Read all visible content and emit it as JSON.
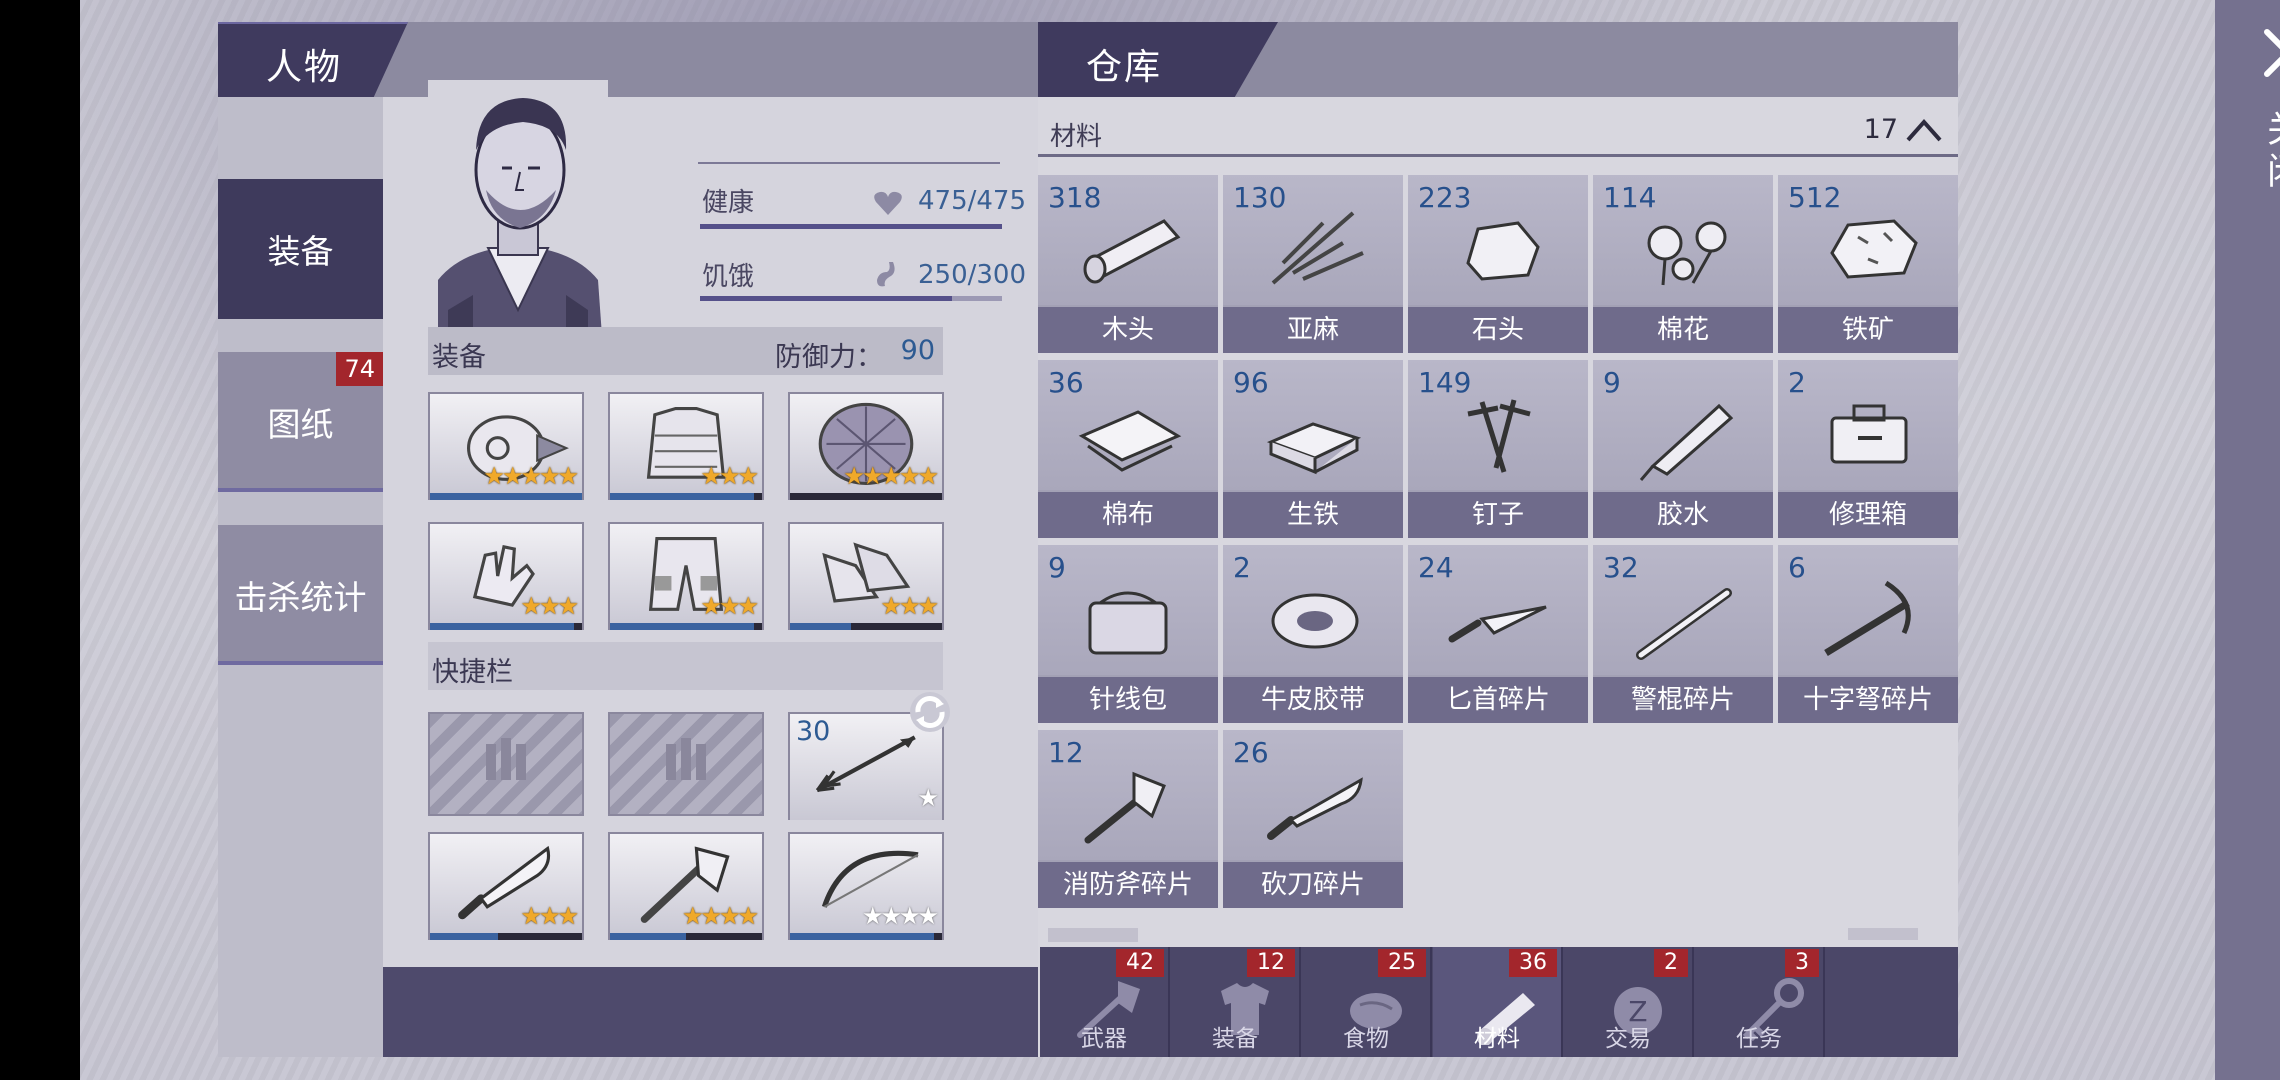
{
  "character": {
    "title": "人物",
    "side_menu": [
      {
        "label": "装备"
      },
      {
        "label": "图纸",
        "badge": "74"
      },
      {
        "label": "击杀统计"
      }
    ],
    "stats": {
      "health_label": "健康",
      "health_value": "475/475",
      "health_fraction": 1.0,
      "hunger_label": "饥饿",
      "hunger_value": "250/300",
      "hunger_fraction": 0.833
    },
    "equipment": {
      "label": "装备",
      "defense_label": "防御力：",
      "defense_value": "90",
      "slots": [
        {
          "icon": "helmet-icon",
          "stars": 5,
          "durability": 1.0
        },
        {
          "icon": "armor-vest-icon",
          "stars": 3,
          "durability": 0.95
        },
        {
          "icon": "turtle-shell-icon",
          "stars": 5,
          "durability": 0.0
        },
        {
          "icon": "gloves-icon",
          "stars": 3,
          "durability": 0.95
        },
        {
          "icon": "pants-icon",
          "stars": 3,
          "durability": 0.95
        },
        {
          "icon": "boots-icon",
          "stars": 3,
          "durability": 0.4
        }
      ]
    },
    "quickbar": {
      "label": "快捷栏",
      "slots": [
        {
          "icon": "ammo-empty-icon",
          "empty": true
        },
        {
          "icon": "ammo-empty-icon",
          "empty": true
        },
        {
          "icon": "arrow-icon",
          "count": "30",
          "stars": 1,
          "star_style": "white"
        },
        {
          "icon": "machete-icon",
          "stars": 3,
          "durability": 0.45
        },
        {
          "icon": "axe-icon",
          "stars": 4,
          "durability": 0.5
        },
        {
          "icon": "bow-icon",
          "stars": 4,
          "star_style": "white",
          "durability": 0.95
        }
      ]
    }
  },
  "warehouse": {
    "title": "仓库",
    "category": {
      "name": "材料",
      "count": "17"
    },
    "items": [
      {
        "qty": "318",
        "name": "木头",
        "icon": "wood-log-icon"
      },
      {
        "qty": "130",
        "name": "亚麻",
        "icon": "flax-icon"
      },
      {
        "qty": "223",
        "name": "石头",
        "icon": "stone-icon"
      },
      {
        "qty": "114",
        "name": "棉花",
        "icon": "cotton-icon"
      },
      {
        "qty": "512",
        "name": "铁矿",
        "icon": "iron-ore-icon"
      },
      {
        "qty": "36",
        "name": "棉布",
        "icon": "cloth-icon"
      },
      {
        "qty": "96",
        "name": "生铁",
        "icon": "iron-ingot-icon"
      },
      {
        "qty": "149",
        "name": "钉子",
        "icon": "nails-icon"
      },
      {
        "qty": "9",
        "name": "胶水",
        "icon": "glue-icon"
      },
      {
        "qty": "2",
        "name": "修理箱",
        "icon": "repair-kit-icon"
      },
      {
        "qty": "9",
        "name": "针线包",
        "icon": "sewing-kit-icon"
      },
      {
        "qty": "2",
        "name": "牛皮胶带",
        "icon": "duct-tape-icon"
      },
      {
        "qty": "24",
        "name": "匕首碎片",
        "icon": "dagger-part-icon"
      },
      {
        "qty": "32",
        "name": "警棍碎片",
        "icon": "baton-part-icon"
      },
      {
        "qty": "6",
        "name": "十字弩碎片",
        "icon": "crossbow-part-icon"
      },
      {
        "qty": "12",
        "name": "消防斧碎片",
        "icon": "fire-axe-part-icon"
      },
      {
        "qty": "26",
        "name": "砍刀碎片",
        "icon": "machete-part-icon"
      }
    ],
    "tabs": [
      {
        "label": "武器",
        "badge": "42",
        "icon": "axe-icon"
      },
      {
        "label": "装备",
        "badge": "12",
        "icon": "shirt-icon"
      },
      {
        "label": "食物",
        "badge": "25",
        "icon": "meat-icon"
      },
      {
        "label": "材料",
        "badge": "36",
        "icon": "log-icon",
        "active": true
      },
      {
        "label": "交易",
        "badge": "2",
        "icon": "coin-icon"
      },
      {
        "label": "任务",
        "badge": "3",
        "icon": "key-icon"
      }
    ]
  },
  "close": {
    "label": "关闭"
  },
  "colors": {
    "accent": "#3e3a5c",
    "badge": "#a3262c",
    "qty_blue": "#27508c",
    "star": "#f0a92a"
  }
}
